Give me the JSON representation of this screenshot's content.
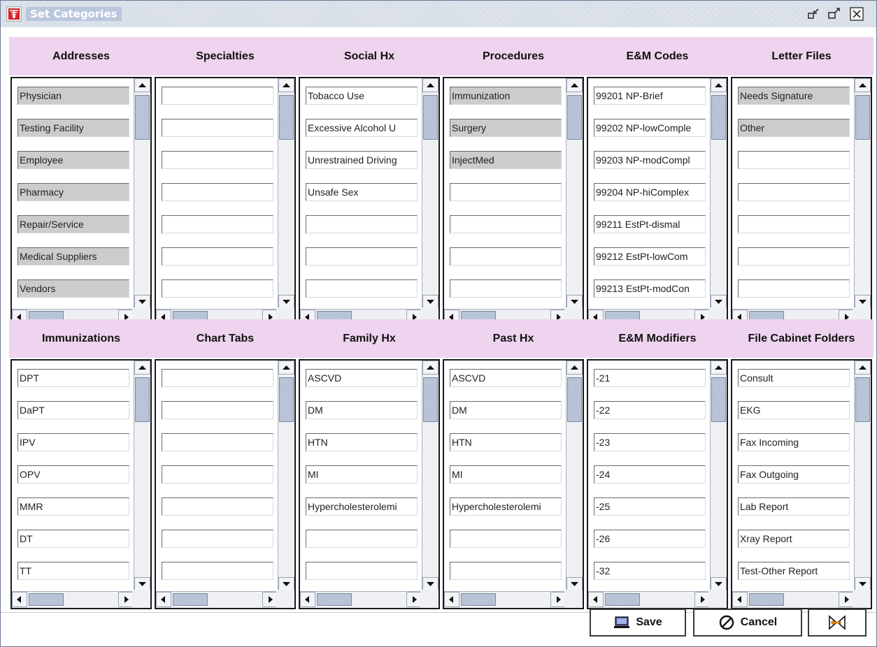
{
  "window": {
    "title": "Set Categories",
    "controls": [
      "minimize-icon",
      "maximize-icon",
      "close-icon"
    ]
  },
  "colors": {
    "header_bg": "#eed4ee",
    "field_gray": "#cccccc",
    "scroll_thumb": "#aebbd0"
  },
  "panels": [
    {
      "title": "Addresses",
      "items": [
        "Physician",
        "Testing Facility",
        "Employee",
        "Pharmacy",
        "Repair/Service",
        "Medical Suppliers",
        "Vendors"
      ],
      "filled": [
        true,
        true,
        true,
        true,
        true,
        true,
        true
      ]
    },
    {
      "title": "Specialties",
      "items": [
        "",
        "",
        "",
        "",
        "",
        "",
        ""
      ],
      "filled": [
        false,
        false,
        false,
        false,
        false,
        false,
        false
      ]
    },
    {
      "title": "Social Hx",
      "items": [
        "Tobacco Use",
        "Excessive Alcohol U",
        "Unrestrained Driving",
        "Unsafe Sex",
        "",
        "",
        ""
      ],
      "filled": [
        false,
        false,
        false,
        false,
        false,
        false,
        false
      ]
    },
    {
      "title": "Procedures",
      "items": [
        "Immunization",
        "Surgery",
        "InjectMed",
        "",
        "",
        "",
        ""
      ],
      "filled": [
        true,
        true,
        true,
        false,
        false,
        false,
        false
      ]
    },
    {
      "title": "E&M Codes",
      "items": [
        "99201 NP-Brief",
        "99202 NP-lowComple",
        "99203 NP-modCompl",
        "99204 NP-hiComplex",
        "99211 EstPt-dismal",
        "99212 EstPt-lowCom",
        "99213 EstPt-modCon"
      ],
      "filled": [
        false,
        false,
        false,
        false,
        false,
        false,
        false
      ]
    },
    {
      "title": "Letter Files",
      "items": [
        "Needs Signature",
        "Other",
        "",
        "",
        "",
        "",
        ""
      ],
      "filled": [
        true,
        true,
        false,
        false,
        false,
        false,
        false
      ]
    },
    {
      "title": "Immunizations",
      "items": [
        "DPT",
        "DaPT",
        "IPV",
        "OPV",
        "MMR",
        "DT",
        "TT"
      ],
      "filled": [
        false,
        false,
        false,
        false,
        false,
        false,
        false
      ]
    },
    {
      "title": "Chart Tabs",
      "items": [
        "",
        "",
        "",
        "",
        "",
        "",
        ""
      ],
      "filled": [
        false,
        false,
        false,
        false,
        false,
        false,
        false
      ]
    },
    {
      "title": "Family Hx",
      "items": [
        "ASCVD",
        "DM",
        "HTN",
        "MI",
        "Hypercholesterolemi",
        "",
        ""
      ],
      "filled": [
        false,
        false,
        false,
        false,
        false,
        false,
        false
      ]
    },
    {
      "title": "Past Hx",
      "items": [
        "ASCVD",
        "DM",
        "HTN",
        "MI",
        "Hypercholesterolemi",
        "",
        ""
      ],
      "filled": [
        false,
        false,
        false,
        false,
        false,
        false,
        false
      ]
    },
    {
      "title": "E&M Modifiers",
      "items": [
        "-21",
        "-22",
        "-23",
        "-24",
        "-25",
        "-26",
        "-32"
      ],
      "filled": [
        false,
        false,
        false,
        false,
        false,
        false,
        false
      ]
    },
    {
      "title": "File Cabinet Folders",
      "items": [
        "Consult",
        "EKG",
        "Fax Incoming",
        "Fax Outgoing",
        "Lab Report",
        "Xray Report",
        "Test-Other Report"
      ],
      "filled": [
        false,
        false,
        false,
        false,
        false,
        false,
        false
      ]
    }
  ],
  "buttons": {
    "save_label": "Save",
    "cancel_label": "Cancel",
    "third_icon": "exit-icon"
  }
}
